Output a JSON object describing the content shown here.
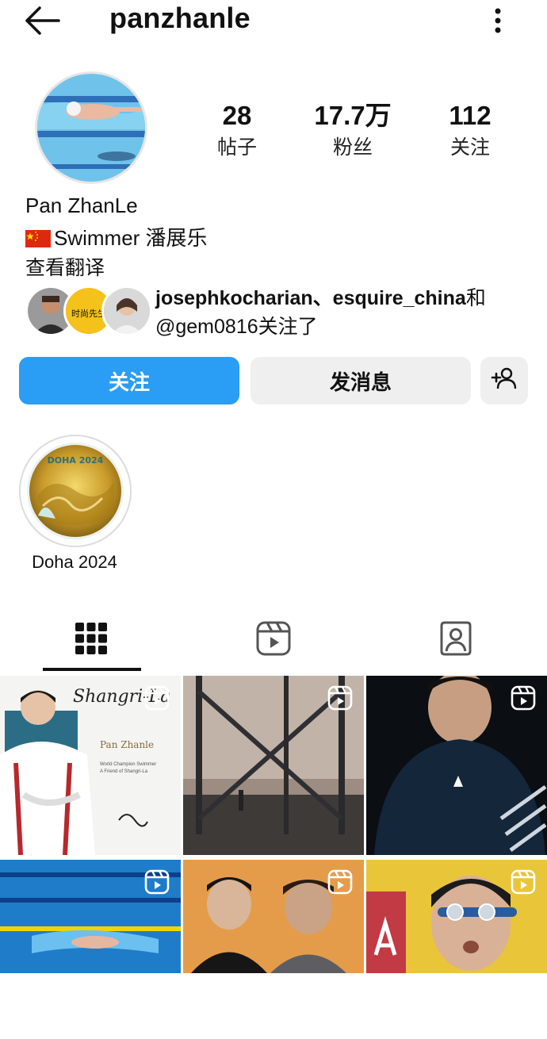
{
  "header": {
    "username": "panzhanle"
  },
  "stats": [
    {
      "value": "28",
      "label": "帖子"
    },
    {
      "value": "17.7万",
      "label": "粉丝"
    },
    {
      "value": "112",
      "label": "关注"
    }
  ],
  "profile": {
    "name": "Pan ZhanLe",
    "bio": "Swimmer 潘展乐",
    "translate": "查看翻译"
  },
  "mutual": {
    "line1_bold": "josephkocharian、esquire_china",
    "line1_tail": "和",
    "line2_handle": "@gem0816",
    "line2_tail": "关注了",
    "avatar_badge_text": "时尚先生"
  },
  "buttons": {
    "follow": "关注",
    "message": "发消息"
  },
  "highlight": {
    "label": "Doha 2024",
    "medal_text": "DOHA 2024"
  },
  "posts": [
    {
      "type": "reel",
      "overlay_title": "Shangri-La",
      "overlay_name": "Pan Zhanle",
      "overlay_caption": "World Champion Swimmer\nA Friend of Shangri-La"
    },
    {
      "type": "reel"
    },
    {
      "type": "reel"
    },
    {
      "type": "reel"
    },
    {
      "type": "reel"
    },
    {
      "type": "reel"
    }
  ],
  "colors": {
    "accent": "#2a9df4",
    "button_gray": "#efefef"
  }
}
